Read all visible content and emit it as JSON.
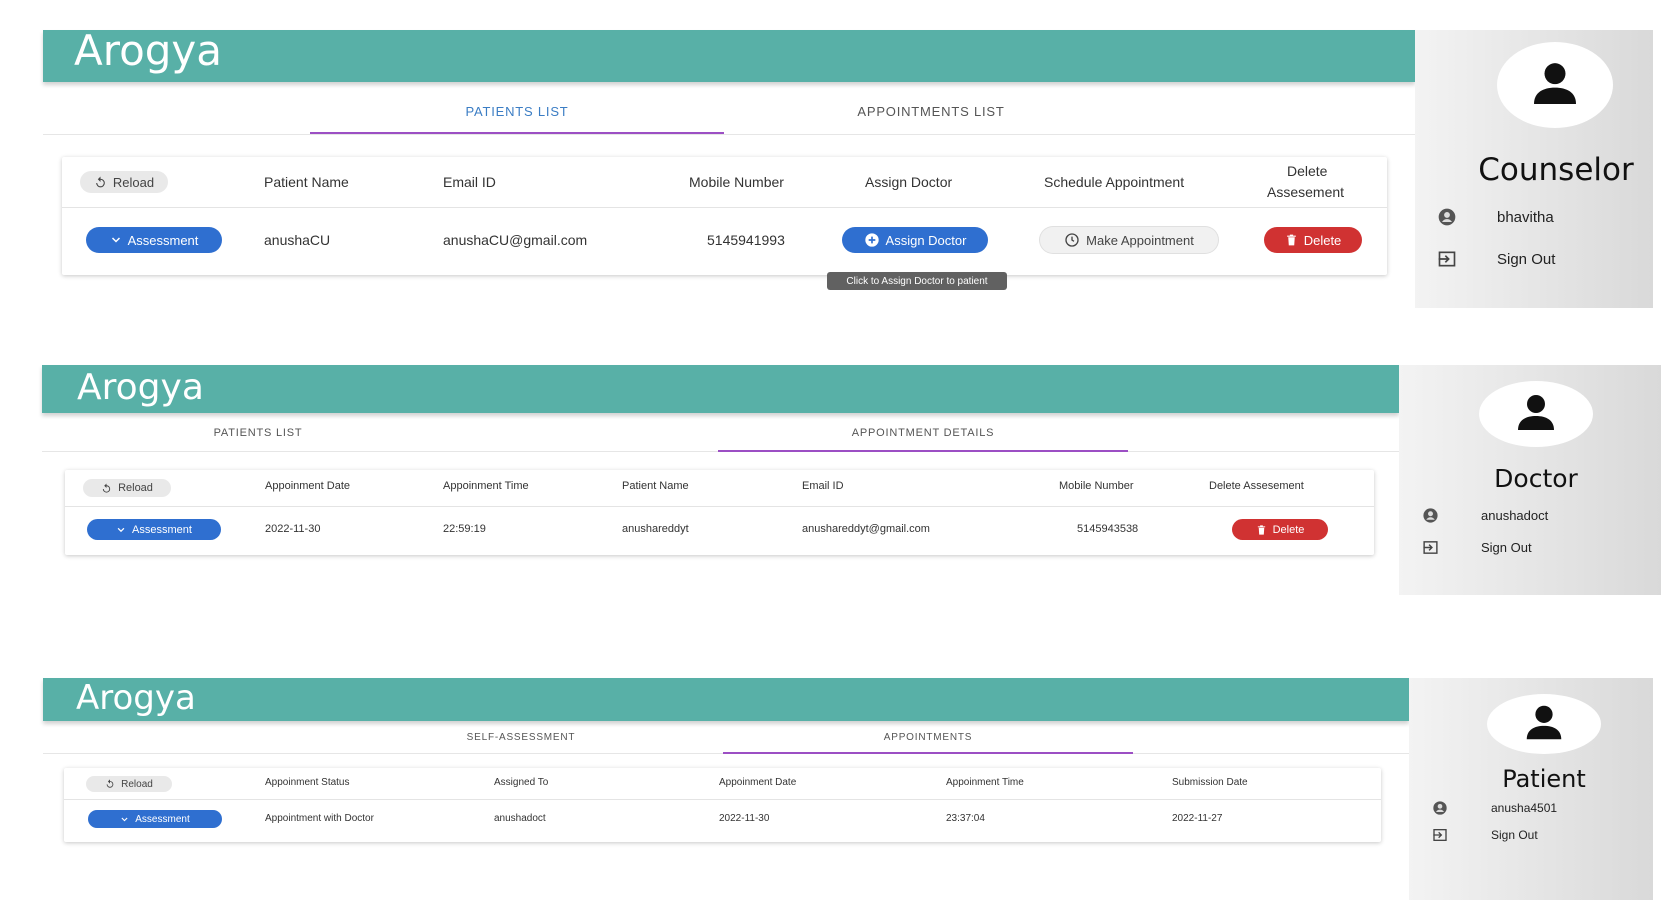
{
  "brand": "Arogya",
  "panels": [
    {
      "tabs": [
        {
          "label": "PATIENTS LIST",
          "active": true
        },
        {
          "label": "APPOINTMENTS LIST",
          "active": false
        }
      ],
      "columns": [
        "Patient Name",
        "Email ID",
        "Mobile Number",
        "Assign Doctor",
        "Schedule Appointment",
        "Delete",
        "Assesement"
      ],
      "reload_label": "Reload",
      "row": {
        "assessment_label": "Assessment",
        "patient_name": "anushaCU",
        "email": "anushaCU@gmail.com",
        "mobile": "5145941993",
        "assign_doctor_label": "Assign Doctor",
        "make_appointment_label": "Make Appointment",
        "delete_label": "Delete"
      },
      "tooltip": "Click to Assign Doctor to patient",
      "sidebar": {
        "role": "Counselor",
        "username": "bhavitha",
        "sign_out": "Sign Out"
      }
    },
    {
      "tabs": [
        {
          "label": "PATIENTS LIST",
          "active": false
        },
        {
          "label": "APPOINTMENT DETAILS",
          "active": true
        }
      ],
      "columns": [
        "Appoinment Date",
        "Appoinment Time",
        "Patient Name",
        "Email ID",
        "Mobile Number",
        "Delete Assesement"
      ],
      "reload_label": "Reload",
      "row": {
        "assessment_label": "Assessment",
        "date": "2022-11-30",
        "time": "22:59:19",
        "patient_name": "anushareddyt",
        "email": "anushareddyt@gmail.com",
        "mobile": "5145943538",
        "delete_label": "Delete"
      },
      "sidebar": {
        "role": "Doctor",
        "username": "anushadoct",
        "sign_out": "Sign Out"
      }
    },
    {
      "tabs": [
        {
          "label": "SELF-ASSESSMENT",
          "active": false
        },
        {
          "label": "APPOINTMENTS",
          "active": true
        }
      ],
      "columns": [
        "Appoinment Status",
        "Assigned To",
        "Appoinment Date",
        "Appoinment Time",
        "Submission Date"
      ],
      "reload_label": "Reload",
      "row": {
        "assessment_label": "Assessment",
        "status": "Appointment with Doctor",
        "assigned_to": "anushadoct",
        "date": "2022-11-30",
        "time": "23:37:04",
        "submission_date": "2022-11-27"
      },
      "sidebar": {
        "role": "Patient",
        "username": "anusha4501",
        "sign_out": "Sign Out"
      }
    }
  ],
  "colors": {
    "header": "#58b0a7",
    "tab_underline": "#9c4fc4",
    "active_tab_text": "#3b7dc4",
    "assessment_chip": "#2f6fd0",
    "delete_chip": "#d03232",
    "tooltip": "#616161"
  },
  "icons": {
    "reload": "reload-icon",
    "chevron": "chevron-down-icon",
    "add": "add-circle-icon",
    "clock": "clock-icon",
    "trash": "trash-icon",
    "avatar": "person-icon",
    "account": "account-circle-icon",
    "sign_out": "sign-out-icon"
  }
}
